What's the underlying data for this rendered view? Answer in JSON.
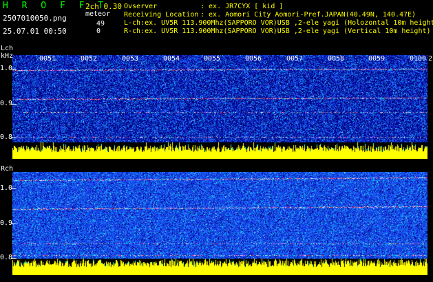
{
  "header": {
    "logo": "H R O F F T",
    "filename": "2507010050.png",
    "datetime": "25.07.01 00:50",
    "mode": "2ch 0.30",
    "meteor_label": "meteor",
    "count_1": "49",
    "count_2": "0",
    "observer_label": "Ovserver",
    "observer_value": ": ex. JR7CYX [ kid ]",
    "location_label": "Receiving Location",
    "location_value": ": ex. Aomori City Aomori-Pref.JAPAN(40.49N, 140.47E)",
    "lch_info": "L-ch:ex. UV5R 113.900Mhz(SAPPORO VOR)USB ,2-ele yagi (Holozontal 10m height)",
    "rch_info": "R-ch:ex. UV5R 113.900Mhz(SAPPORO VOR)USB ,2-ele yagi (Vertical 10m height)"
  },
  "lch": {
    "label": "Lch",
    "unit": "kHz",
    "ticks": [
      "1.0",
      "0.9",
      "0.8"
    ],
    "times": [
      "0051",
      "0052",
      "0053",
      "0054",
      "0055",
      "0056",
      "0057",
      "0058",
      "0059",
      "0100"
    ],
    "end_marker": "2"
  },
  "rch": {
    "label": "Rch",
    "ticks": [
      "1.0",
      "0.9",
      "0.8"
    ]
  },
  "colors": {
    "logo": "#00ff00",
    "info": "#ffff00",
    "waterfall_bg": "#00007a",
    "noise_blue": "#2a5cff",
    "signal_cyan": "#00e0ff",
    "echo_red": "#ff3030",
    "level_bar": "#ffff00"
  }
}
